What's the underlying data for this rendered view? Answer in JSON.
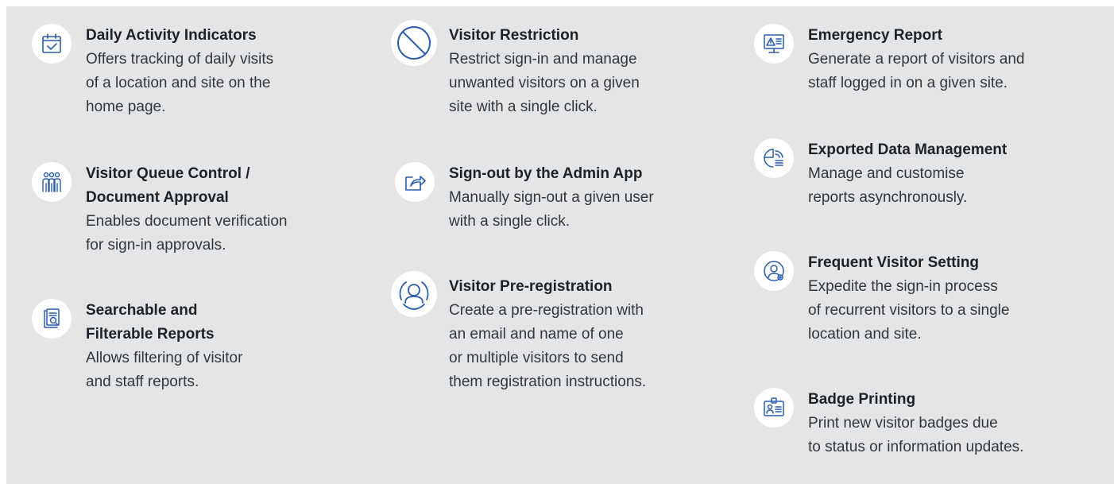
{
  "colors": {
    "accent": "#2a5db0",
    "panel": "#e4e5e6",
    "icon_bg": "#ffffff"
  },
  "columns": [
    {
      "features": [
        {
          "icon": "calendar-check-icon",
          "title": "Daily Activity Indicators",
          "desc": "Offers tracking of daily visits\nof a location and site on the\nhome page."
        },
        {
          "icon": "people-queue-icon",
          "title": "Visitor Queue Control /\nDocument Approval",
          "desc": "Enables document verification\nfor sign-in approvals."
        },
        {
          "icon": "document-search-icon",
          "title": "Searchable and\nFilterable Reports",
          "desc": "Allows filtering of visitor\nand staff reports."
        }
      ]
    },
    {
      "features": [
        {
          "icon": "prohibited-icon",
          "title": "Visitor Restriction",
          "desc": "Restrict sign-in and manage\nunwanted visitors on a given\nsite with a single click."
        },
        {
          "icon": "share-arrow-icon",
          "title": "Sign-out by the Admin App",
          "desc": "Manually sign-out a given user\nwith a single click."
        },
        {
          "icon": "user-circle-icon",
          "title": "Visitor Pre-registration",
          "desc": "Create a pre-registration with\nan email and name of one\nor multiple visitors to send\nthem registration instructions."
        }
      ]
    },
    {
      "features": [
        {
          "icon": "monitor-alert-icon",
          "title": "Emergency Report",
          "desc": "Generate a report of visitors and\nstaff logged in on a given site."
        },
        {
          "icon": "data-export-icon",
          "title": "Exported Data Management",
          "desc": "Manage and customise\nreports asynchronously."
        },
        {
          "icon": "user-settings-icon",
          "title": "Frequent Visitor Setting",
          "desc": "Expedite the sign-in process\nof recurrent visitors to a single\nlocation and site."
        },
        {
          "icon": "id-badge-icon",
          "title": "Badge Printing",
          "desc": "Print new visitor badges due\nto status or information updates."
        }
      ]
    }
  ]
}
